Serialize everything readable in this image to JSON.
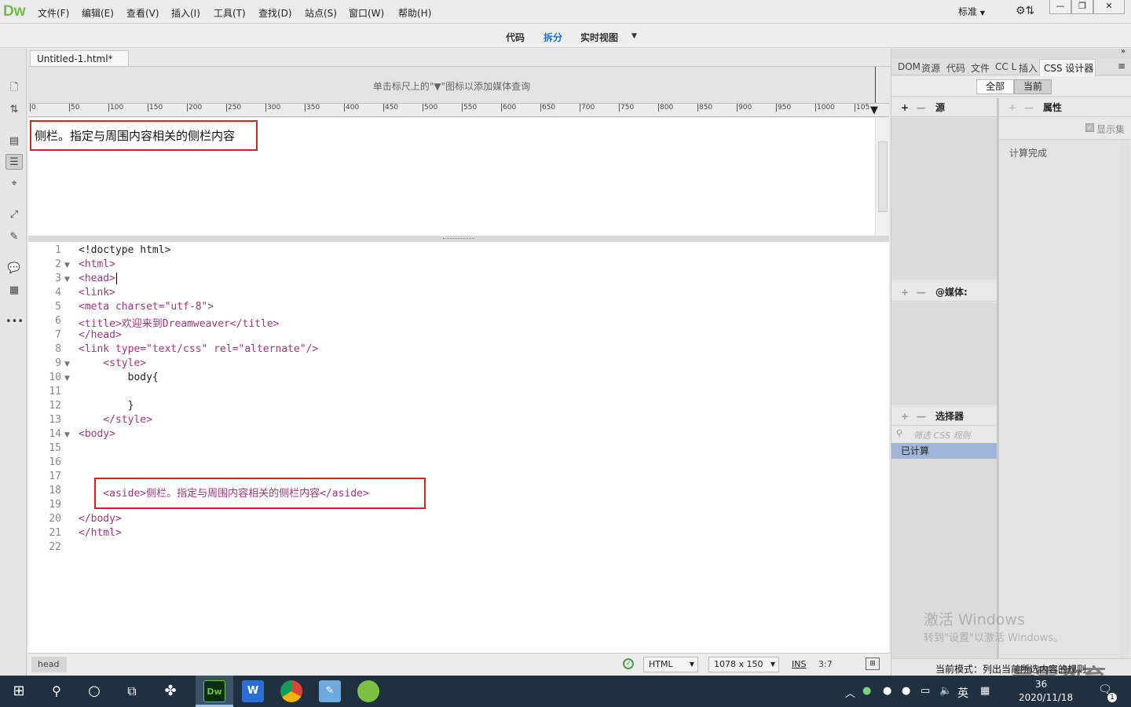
{
  "app": {
    "logo": "Dw"
  },
  "menu": [
    "文件(F)",
    "编辑(E)",
    "查看(V)",
    "插入(I)",
    "工具(T)",
    "查找(D)",
    "站点(S)",
    "窗口(W)",
    "帮助(H)"
  ],
  "workspace": {
    "label": "标准"
  },
  "window_controls": {
    "minimize": "—",
    "restore": "❐",
    "close": "✕"
  },
  "view": {
    "code": "代码",
    "split": "拆分",
    "live": "实时视图"
  },
  "document": {
    "tab_title": "Untitled-1.html*",
    "close_glyph": "×"
  },
  "media_query_bar": {
    "text": "单击标尺上的\"▼\"图标以添加媒体查询"
  },
  "ruler": {
    "ticks": [
      "0",
      "50",
      "100",
      "150",
      "200",
      "250",
      "300",
      "350",
      "400",
      "450",
      "500",
      "550",
      "600",
      "650",
      "700",
      "750",
      "800",
      "850",
      "900",
      "950",
      "1000",
      "105"
    ]
  },
  "design_view": {
    "aside_text": "侧栏。指定与周围内容相关的侧栏内容"
  },
  "code_lines": [
    {
      "n": "1",
      "fold": "",
      "text": "<!doctype html>"
    },
    {
      "n": "2",
      "fold": "▼",
      "text": "<html>"
    },
    {
      "n": "3",
      "fold": "▼",
      "text": "<head>"
    },
    {
      "n": "4",
      "fold": "",
      "text": "<link>"
    },
    {
      "n": "5",
      "fold": "",
      "text": "<meta charset=\"utf-8\">"
    },
    {
      "n": "6",
      "fold": "",
      "text": "<title>欢迎来到Dreamweaver</title>"
    },
    {
      "n": "7",
      "fold": "",
      "text": "</head>"
    },
    {
      "n": "8",
      "fold": "",
      "text": "<link type=\"text/css\" rel=\"alternate\"/>"
    },
    {
      "n": "9",
      "fold": "▼",
      "text": "    <style>"
    },
    {
      "n": "10",
      "fold": "▼",
      "text": "        body{"
    },
    {
      "n": "11",
      "fold": "",
      "text": ""
    },
    {
      "n": "12",
      "fold": "",
      "text": "        }"
    },
    {
      "n": "13",
      "fold": "",
      "text": "    </style>"
    },
    {
      "n": "14",
      "fold": "▼",
      "text": "<body>"
    },
    {
      "n": "15",
      "fold": "",
      "text": ""
    },
    {
      "n": "16",
      "fold": "",
      "text": ""
    },
    {
      "n": "17",
      "fold": "",
      "text": ""
    },
    {
      "n": "18",
      "fold": "",
      "text": "    <aside>侧栏。指定与周围内容相关的侧栏内容</aside>"
    },
    {
      "n": "19",
      "fold": "",
      "text": ""
    },
    {
      "n": "20",
      "fold": "",
      "text": "</body>"
    },
    {
      "n": "21",
      "fold": "",
      "text": "</html>"
    },
    {
      "n": "22",
      "fold": "",
      "text": ""
    }
  ],
  "status": {
    "tag": "head",
    "doctype": "HTML",
    "size": "1078 x 150",
    "mode": "INS",
    "position": "3:7"
  },
  "right_panel": {
    "tabs": [
      "DOM",
      "资源",
      "代码",
      "文件",
      "CC L",
      "插入",
      "CSS 设计器"
    ],
    "toggle_all": "全部",
    "toggle_current": "当前",
    "sources_label": "源",
    "properties_label": "属性",
    "show_set": "显示集",
    "computed_done": "计算完成",
    "media_label": "@媒体:",
    "selectors_label": "选择器",
    "filter_placeholder": "筛选 CSS 规则",
    "computed_item": "已计算",
    "footer": "当前模式：列出当前所选内容的规则"
  },
  "watermark": {
    "line1": "激活 Windows",
    "line2": "转到\"设置\"以激活 Windows。",
    "brand": "最需教育"
  },
  "taskbar": {
    "lang": "英",
    "time_partial": "36",
    "date": "2020/11/18",
    "notif_count": "1"
  }
}
